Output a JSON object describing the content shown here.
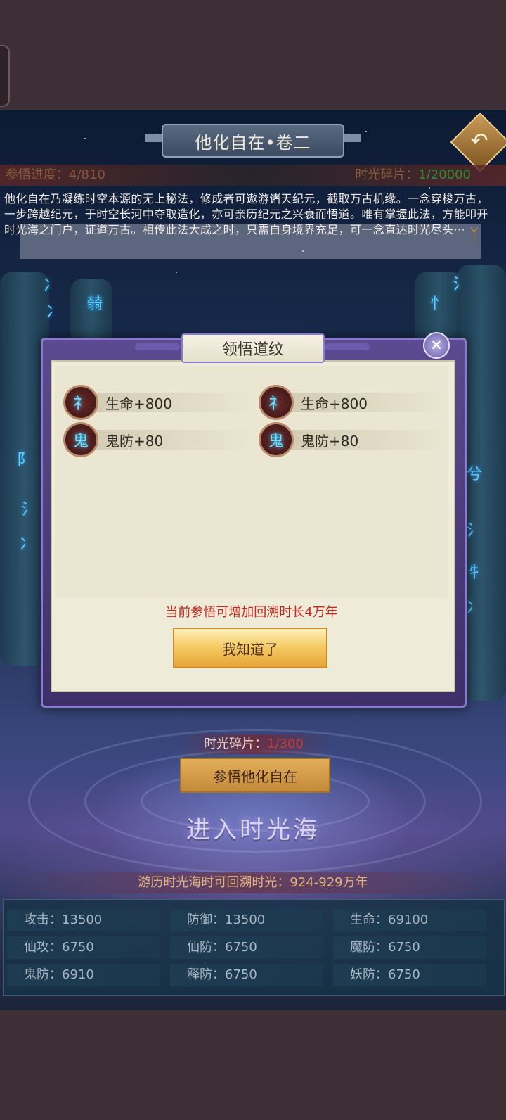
{
  "header": {
    "title": "他化自在•卷二",
    "back_icon": "back-arrow-icon"
  },
  "progress": {
    "label": "参悟进度：",
    "value": "4/810",
    "shard_label": "时光碎片：",
    "shard_value": "1/20000"
  },
  "description": "他化自在乃凝练时空本源的无上秘法，修成者可遨游诸天纪元，截取万古机缘。一念穿梭万古，一步跨越纪元，于时空长河中夺取造化，亦可亲历纪元之兴衰而悟道。唯有掌握此法，方能叩开时光海之门户，证道万古。相传此法大成之时，只需自身境界充足，可一念直达时光尽头···",
  "modal": {
    "title": "领悟道纹",
    "close_icon": "close-icon",
    "stats": [
      {
        "rune": "礻",
        "label": "生命+800"
      },
      {
        "rune": "礻",
        "label": "生命+800"
      },
      {
        "rune": "鬼",
        "label": "鬼防+80"
      },
      {
        "rune": "鬼",
        "label": "鬼防+80"
      }
    ],
    "hint": "当前参悟可增加回溯时长4万年",
    "confirm_label": "我知道了"
  },
  "shard_cost": {
    "label": "时光碎片：",
    "value": "1/300"
  },
  "comprehend_label": "参悟他化自在",
  "enter_sea_label": "进入时光海",
  "roam_text": "游历时光海时可回溯时光：924-929万年",
  "attributes": [
    [
      "攻击：13500",
      "防御：13500",
      "生命：69100"
    ],
    [
      "仙攻：6750",
      "仙防：6750",
      "魔防：6750"
    ],
    [
      "鬼防：6910",
      "释防：6750",
      "妖防：6750"
    ]
  ],
  "colors": {
    "accent_gold": "#e7a43a",
    "hint_red": "#c8281e",
    "progress_green": "#2e8d2e",
    "modal_purple": "#5c4a90"
  }
}
